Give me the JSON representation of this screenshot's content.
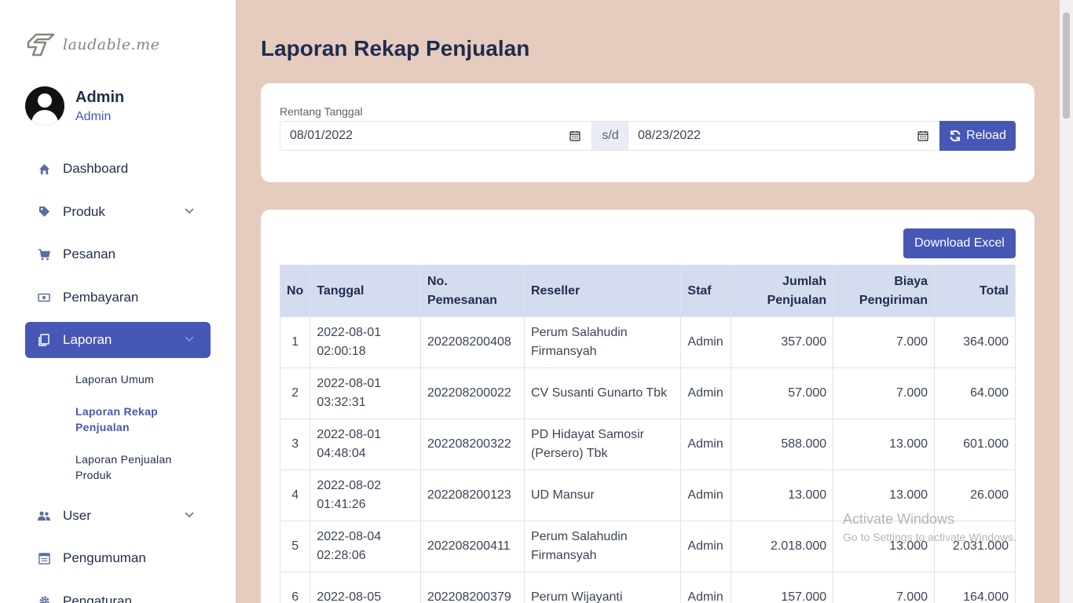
{
  "brand": {
    "name": "laudable.me"
  },
  "profile": {
    "name": "Admin",
    "role": "Admin"
  },
  "nav": {
    "dashboard": "Dashboard",
    "produk": "Produk",
    "pesanan": "Pesanan",
    "pembayaran": "Pembayaran",
    "laporan": "Laporan",
    "laporan_sub": [
      "Laporan Umum",
      "Laporan Rekap Penjualan",
      "Laporan Penjualan Produk"
    ],
    "user": "User",
    "pengumuman": "Pengumuman",
    "pengaturan": "Pengaturan"
  },
  "page": {
    "title": "Laporan Rekap Penjualan"
  },
  "filter": {
    "label": "Rentang Tanggal",
    "start_date": "08/01/2022",
    "separator": "s/d",
    "end_date": "08/23/2022",
    "reload_label": "Reload"
  },
  "table": {
    "download_label": "Download Excel",
    "headers": {
      "no": "No",
      "tanggal": "Tanggal",
      "no_pemesanan": "No. Pemesanan",
      "reseller": "Reseller",
      "staf": "Staf",
      "jumlah_penjualan": "Jumlah Penjualan",
      "biaya_pengiriman": "Biaya Pengiriman",
      "total": "Total"
    },
    "rows": [
      {
        "no": "1",
        "tanggal": "2022-08-01 02:00:18",
        "no_pemesanan": "202208200408",
        "reseller": "Perum Salahudin Firmansyah",
        "staf": "Admin",
        "jumlah": "357.000",
        "biaya": "7.000",
        "total": "364.000"
      },
      {
        "no": "2",
        "tanggal": "2022-08-01 03:32:31",
        "no_pemesanan": "202208200022",
        "reseller": "CV Susanti Gunarto Tbk",
        "staf": "Admin",
        "jumlah": "57.000",
        "biaya": "7.000",
        "total": "64.000"
      },
      {
        "no": "3",
        "tanggal": "2022-08-01 04:48:04",
        "no_pemesanan": "202208200322",
        "reseller": "PD Hidayat Samosir (Persero) Tbk",
        "staf": "Admin",
        "jumlah": "588.000",
        "biaya": "13.000",
        "total": "601.000"
      },
      {
        "no": "4",
        "tanggal": "2022-08-02 01:41:26",
        "no_pemesanan": "202208200123",
        "reseller": "UD Mansur",
        "staf": "Admin",
        "jumlah": "13.000",
        "biaya": "13.000",
        "total": "26.000"
      },
      {
        "no": "5",
        "tanggal": "2022-08-04 02:28:06",
        "no_pemesanan": "202208200411",
        "reseller": "Perum Salahudin Firmansyah",
        "staf": "Admin",
        "jumlah": "2.018.000",
        "biaya": "13.000",
        "total": "2.031.000"
      },
      {
        "no": "6",
        "tanggal": "2022-08-05",
        "no_pemesanan": "202208200379",
        "reseller": "Perum Wijayanti",
        "staf": "Admin",
        "jumlah": "157.000",
        "biaya": "7.000",
        "total": "164.000"
      }
    ]
  },
  "watermark": {
    "line1": "Activate Windows",
    "line2": "Go to Settings to activate Windows."
  },
  "colors": {
    "accent": "#4657b5",
    "background": "#e6cbbf",
    "header_bg": "#d5dcf0",
    "text": "#1f2d4d"
  }
}
